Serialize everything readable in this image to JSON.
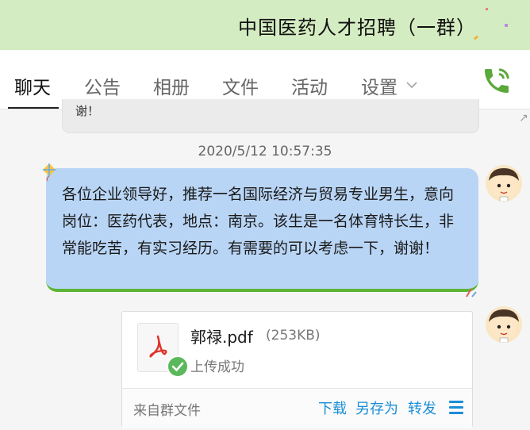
{
  "window": {
    "title": "中国医药人才招聘（一群）"
  },
  "tabs": [
    {
      "label": "聊天",
      "active": true
    },
    {
      "label": "公告",
      "active": false
    },
    {
      "label": "相册",
      "active": false
    },
    {
      "label": "文件",
      "active": false
    },
    {
      "label": "活动",
      "active": false
    },
    {
      "label": "设置",
      "active": false
    }
  ],
  "toolbar": {
    "settings_icon": "chevron-down-icon",
    "call_icon": "phone-icon"
  },
  "chat": {
    "previous_message_tail": "谢！",
    "timestamp": "2020/5/12 10:57:35",
    "message": "各位企业领导好，推荐一名国际经济与贸易专业男生，意向岗位：医药代表，地点：南京。该生是一名体育特长生，非常能吃苦，有实习经历。有需要的可以考虑一下，谢谢！",
    "file": {
      "name": "郭禄.pdf",
      "size": "(253KB)",
      "status": "上传成功",
      "source": "来自群文件",
      "actions": {
        "download": "下载",
        "save_as": "另存为",
        "forward": "转发"
      }
    }
  },
  "colors": {
    "titlebar_bg": "#d4ecc1",
    "bubble_bg": "#b9d5f5",
    "bubble_border": "#5cb535",
    "link": "#1a8ed8",
    "phone_green": "#5aa93a",
    "pdf_red": "#e0312b"
  }
}
